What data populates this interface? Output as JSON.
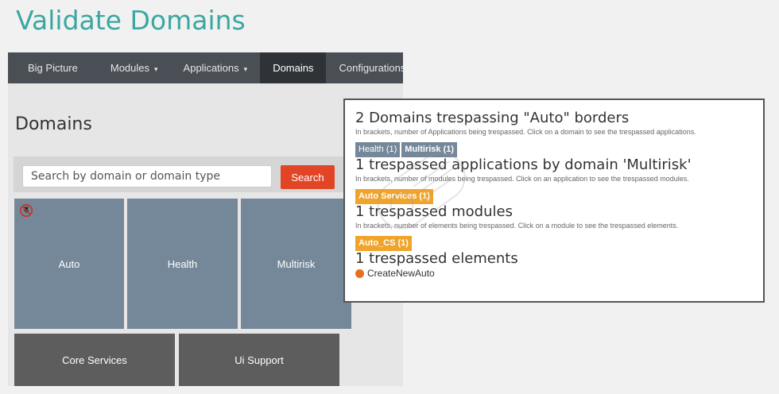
{
  "page_title": "Validate Domains",
  "nav": {
    "items": [
      {
        "label": "Big Picture",
        "caret": false,
        "active": false
      },
      {
        "label": "Modules",
        "caret": true,
        "active": false
      },
      {
        "label": "Applications",
        "caret": true,
        "active": false
      },
      {
        "label": "Domains",
        "caret": false,
        "active": true
      },
      {
        "label": "Configurations",
        "caret": true,
        "active": false
      }
    ]
  },
  "section_title": "Domains",
  "search": {
    "placeholder": "Search by domain or domain type",
    "button_label": "Search"
  },
  "tiles": {
    "auto": "Auto",
    "health": "Health",
    "multirisk": "Multirisk",
    "core_services": "Core Services",
    "ui_support": "Ui Support"
  },
  "panel": {
    "s1": {
      "title": "2 Domains trespassing \"Auto\" borders",
      "subtitle": "In brackets, number of Applications being trespassed. Click on a domain to see the trespassed applications.",
      "tags": [
        "Health (1)",
        "Multirisk (1)"
      ]
    },
    "s2": {
      "title": "1 trespassed applications by domain 'Multirisk'",
      "subtitle": "In brackets, number of modules being trespassed. Click on an application to see the trespassed modules.",
      "tags": [
        "Auto Services (1)"
      ]
    },
    "s3": {
      "title": "1 trespassed modules",
      "subtitle": "In brackets, number of elements being trespassed. Click on a module to see the trespassed elements.",
      "tags": [
        "Auto_CS (1)"
      ]
    },
    "s4": {
      "title": "1 trespassed elements",
      "elements": [
        "CreateNewAuto"
      ]
    }
  },
  "colors": {
    "title": "#3aa7a1",
    "nav_bg": "#4a4f55",
    "tile_blue": "#74889a",
    "tile_gray": "#5d5d5d",
    "search_button": "#e24526",
    "orange_tag": "#f1a42b",
    "element_dot": "#e8701c"
  }
}
